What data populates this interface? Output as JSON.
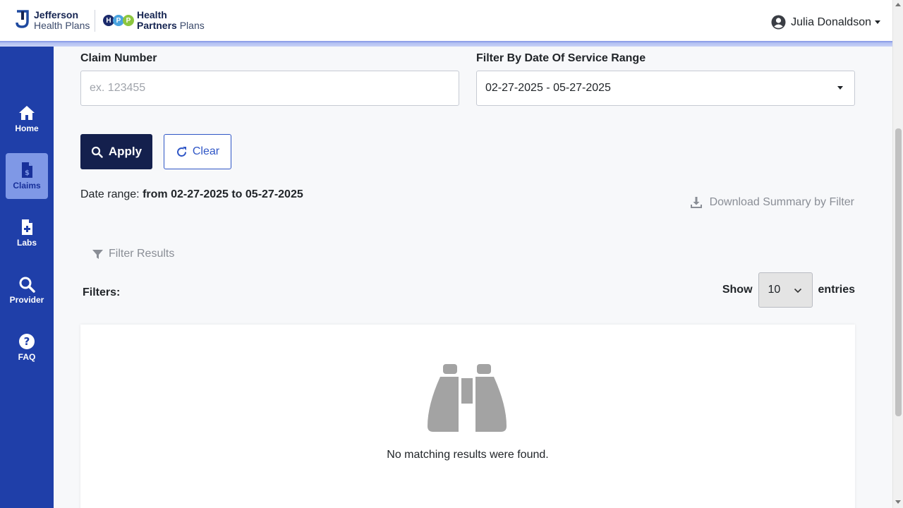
{
  "header": {
    "logo_jefferson": {
      "line1": "Jefferson",
      "line2": "Health Plans"
    },
    "logo_hpp": {
      "dots": [
        "H",
        "P",
        "P"
      ],
      "line1": "Health",
      "line2_bold": "Partners",
      "line2_light": "Plans"
    },
    "user_name": "Julia Donaldson"
  },
  "sidebar": {
    "items": [
      {
        "label": "Home",
        "icon": "home-icon",
        "active": false
      },
      {
        "label": "Claims",
        "icon": "claims-file-dollar-icon",
        "active": true
      },
      {
        "label": "Labs",
        "icon": "labs-file-plus-icon",
        "active": false
      },
      {
        "label": "Provider",
        "icon": "search-icon",
        "active": false
      },
      {
        "label": "FAQ",
        "icon": "question-circle-icon",
        "active": false
      }
    ]
  },
  "form": {
    "claim_number_label": "Claim Number",
    "claim_number_placeholder": "ex. 123455",
    "claim_number_value": "",
    "date_filter_label": "Filter By Date Of Service Range",
    "date_filter_value": "02-27-2025 - 05-27-2025",
    "apply_label": "Apply",
    "clear_label": "Clear"
  },
  "summary": {
    "date_range_prefix": "Date range:",
    "date_range_value": "from 02-27-2025 to 05-27-2025",
    "download_label": "Download Summary by Filter"
  },
  "filters": {
    "filter_results_label": "Filter Results",
    "filters_label": "Filters:",
    "show_label": "Show",
    "entries_value": "10",
    "entries_label": "entries"
  },
  "results": {
    "empty_message": "No matching results were found."
  },
  "colors": {
    "sidebar_bg": "#1f3fa9",
    "sidebar_active_bg": "#7f98e6",
    "apply_bg": "#14204d",
    "clear_border": "#2f56c6",
    "header_accent": "#8fa0e8",
    "page_bg": "#f7f8fa"
  }
}
